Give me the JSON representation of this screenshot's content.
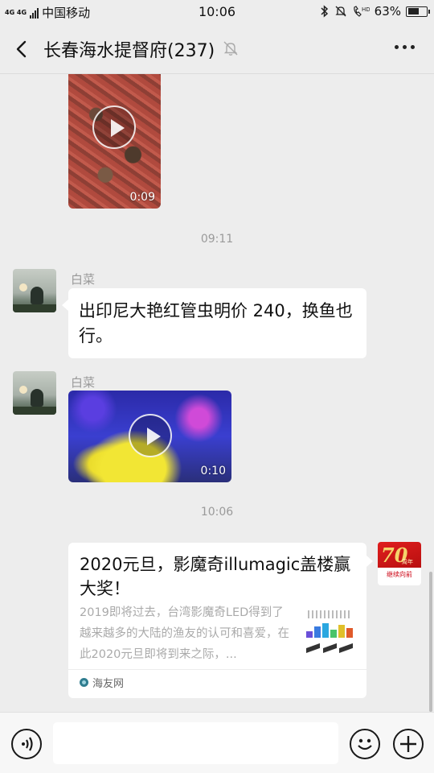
{
  "status_bar": {
    "network": "4G 4G",
    "carrier": "中国移动",
    "time": "10:06",
    "hd": "HD",
    "battery_percent": "63%",
    "battery_level": 0.63
  },
  "header": {
    "title": "长春海水提督府(237)",
    "back_icon": "back-arrow-icon",
    "mute_icon": "muted-bell-icon",
    "more_icon": "more-dots-icon"
  },
  "messages": {
    "video1": {
      "duration": "0:09"
    },
    "time1": "09:11",
    "msg1": {
      "sender": "白菜",
      "text": "出印尼大艳红管虫明价 240，换鱼也行。"
    },
    "msg2": {
      "sender": "白菜",
      "video_duration": "0:10"
    },
    "time2": "10:06",
    "link_card": {
      "title": "2020元旦，影魔奇illumagic盖楼赢大奖！",
      "description": "2019即将过去，台湾影魔奇LED得到了越来越多的大陆的渔友的认可和喜爱，在此2020元旦即将到来之际，...",
      "source": "海友网"
    },
    "self_avatar": {
      "caption": "继续向前",
      "number": "70",
      "note": "周年"
    }
  },
  "input_bar": {
    "voice_icon": "voice-icon",
    "emoji_icon": "emoji-icon",
    "plus_icon": "plus-icon"
  },
  "colors": {
    "background": "#ededed",
    "bubble": "#ffffff",
    "muted_text": "#999999"
  }
}
